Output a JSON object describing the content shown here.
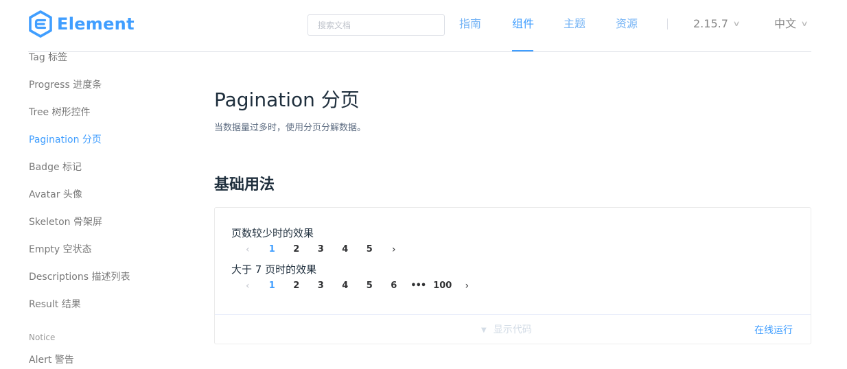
{
  "brand": {
    "name": "Element",
    "color": "#409eff"
  },
  "header": {
    "search_placeholder": "搜索文档",
    "nav": [
      {
        "label": "指南",
        "active": false
      },
      {
        "label": "组件",
        "active": true
      },
      {
        "label": "主题",
        "active": false
      },
      {
        "label": "资源",
        "active": false
      }
    ],
    "version": "2.15.7",
    "language": "中文"
  },
  "sidebar": {
    "items": [
      {
        "label": "Tag 标签",
        "active": false
      },
      {
        "label": "Progress 进度条",
        "active": false
      },
      {
        "label": "Tree 树形控件",
        "active": false
      },
      {
        "label": "Pagination 分页",
        "active": true
      },
      {
        "label": "Badge 标记",
        "active": false
      },
      {
        "label": "Avatar 头像",
        "active": false
      },
      {
        "label": "Skeleton 骨架屏",
        "active": false
      },
      {
        "label": "Empty 空状态",
        "active": false
      },
      {
        "label": "Descriptions 描述列表",
        "active": false
      },
      {
        "label": "Result 结果",
        "active": false
      }
    ],
    "group_title": "Notice",
    "group_items": [
      {
        "label": "Alert 警告",
        "active": false
      }
    ]
  },
  "main": {
    "title": "Pagination 分页",
    "description": "当数据量过多时，使用分页分解数据。",
    "section_title": "基础用法",
    "demo": {
      "example1": {
        "label": "页数较少时的效果",
        "prev_icon": "chevron-left-icon",
        "pages": [
          "1",
          "2",
          "3",
          "4",
          "5"
        ],
        "current": "1",
        "next_icon": "chevron-right-icon"
      },
      "example2": {
        "label": "大于 7 页时的效果",
        "prev_icon": "chevron-left-icon",
        "pages": [
          "1",
          "2",
          "3",
          "4",
          "5",
          "6",
          "•••",
          "100"
        ],
        "current": "1",
        "next_icon": "chevron-right-icon"
      },
      "show_code_label": "显示代码",
      "show_code_icon": "caret-down-icon",
      "run_online_label": "在线运行"
    }
  }
}
